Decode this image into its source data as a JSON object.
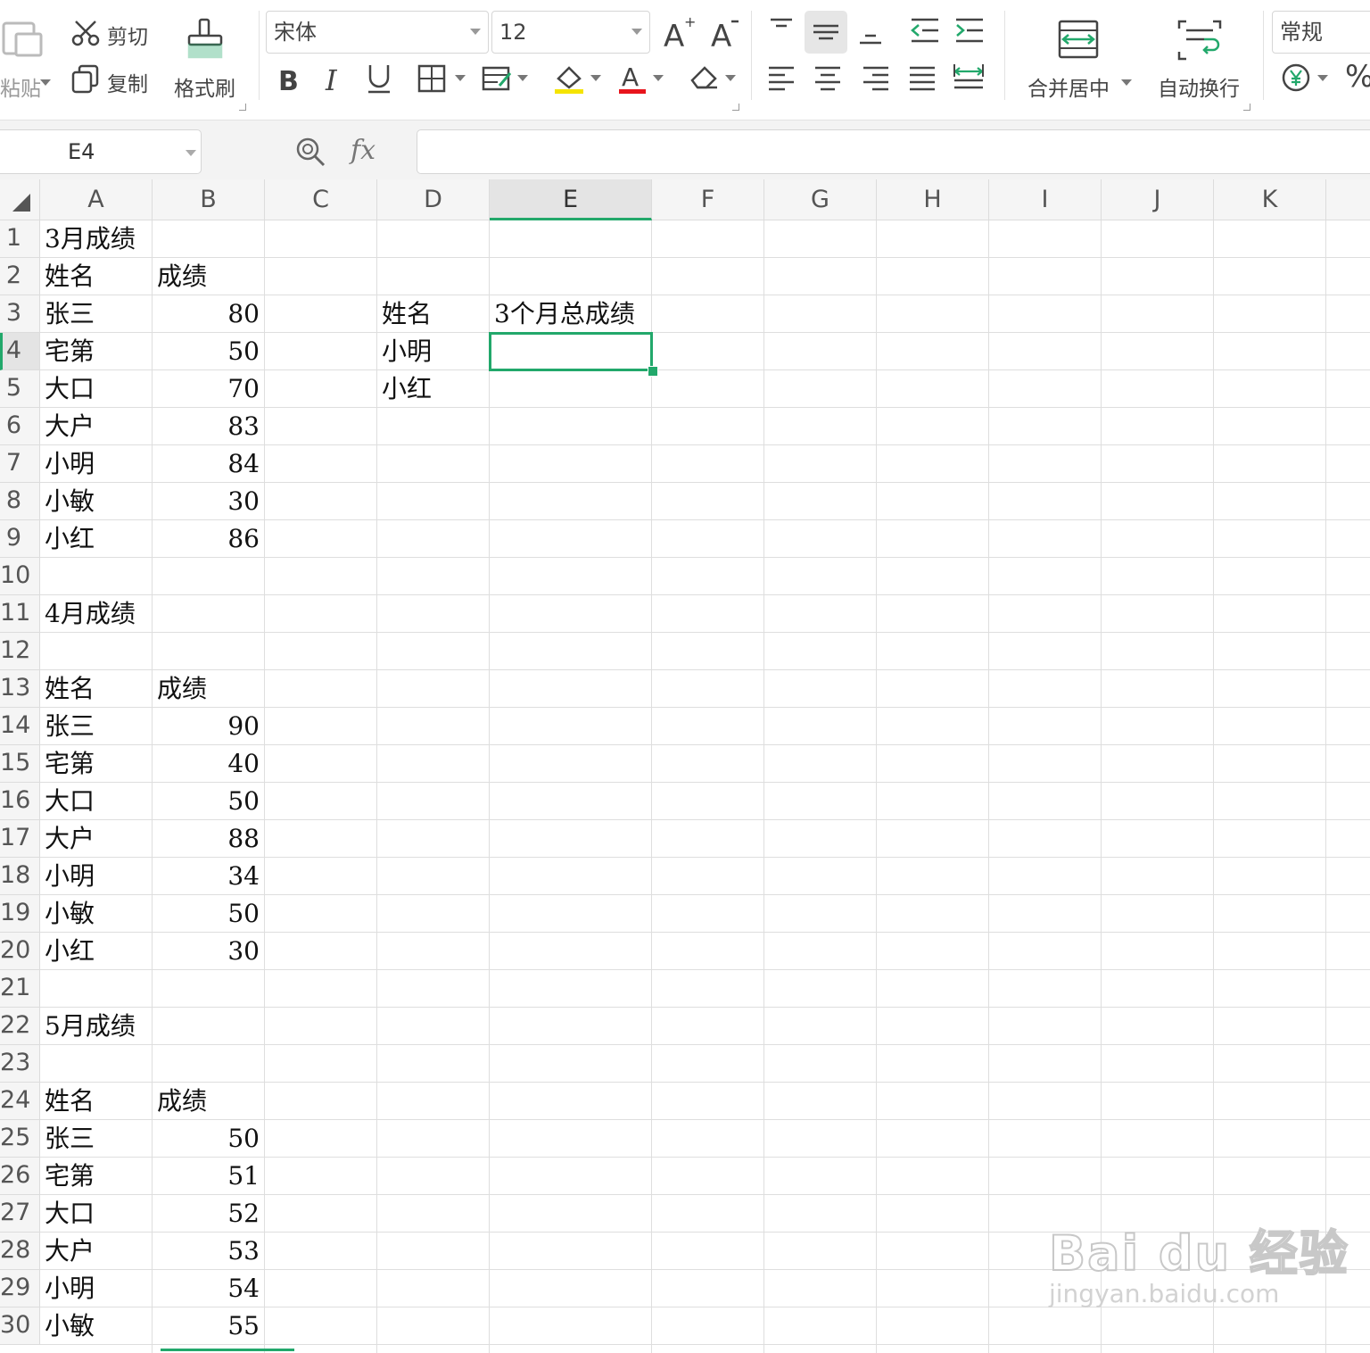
{
  "toolbar": {
    "paste_label": "粘贴",
    "cut_label": "剪切",
    "copy_label": "复制",
    "format_painter_label": "格式刷",
    "font_name": "宋体",
    "font_size": "12",
    "merge_center_label": "合并居中",
    "wrap_text_label": "自动换行",
    "number_format": "常规",
    "percent_symbol": "%",
    "accent_color": "#22a86b"
  },
  "formula_bar": {
    "name_box": "E4",
    "fx_label": "fx",
    "formula_value": ""
  },
  "sheet": {
    "columns": [
      "A",
      "B",
      "C",
      "D",
      "E",
      "F",
      "G",
      "H",
      "I",
      "J",
      "K"
    ],
    "selected_column": "E",
    "selected_row": "4",
    "selected_cell": "E4",
    "rows": [
      {
        "n": "1",
        "a": "3月成绩",
        "b": "",
        "d": "",
        "e": ""
      },
      {
        "n": "2",
        "a": "姓名",
        "b": "成绩",
        "d": "",
        "e": ""
      },
      {
        "n": "3",
        "a": "张三",
        "b": "80",
        "d": "姓名",
        "e": "3个月总成绩"
      },
      {
        "n": "4",
        "a": "宅第",
        "b": "50",
        "d": "小明",
        "e": ""
      },
      {
        "n": "5",
        "a": "大口",
        "b": "70",
        "d": "小红",
        "e": ""
      },
      {
        "n": "6",
        "a": "大户",
        "b": "83",
        "d": "",
        "e": ""
      },
      {
        "n": "7",
        "a": "小明",
        "b": "84",
        "d": "",
        "e": ""
      },
      {
        "n": "8",
        "a": "小敏",
        "b": "30",
        "d": "",
        "e": ""
      },
      {
        "n": "9",
        "a": "小红",
        "b": "86",
        "d": "",
        "e": ""
      },
      {
        "n": "10",
        "a": "",
        "b": "",
        "d": "",
        "e": ""
      },
      {
        "n": "11",
        "a": "4月成绩",
        "b": "",
        "d": "",
        "e": ""
      },
      {
        "n": "12",
        "a": "",
        "b": "",
        "d": "",
        "e": ""
      },
      {
        "n": "13",
        "a": "姓名",
        "b": "成绩",
        "d": "",
        "e": ""
      },
      {
        "n": "14",
        "a": "张三",
        "b": "90",
        "d": "",
        "e": ""
      },
      {
        "n": "15",
        "a": "宅第",
        "b": "40",
        "d": "",
        "e": ""
      },
      {
        "n": "16",
        "a": "大口",
        "b": "50",
        "d": "",
        "e": ""
      },
      {
        "n": "17",
        "a": "大户",
        "b": "88",
        "d": "",
        "e": ""
      },
      {
        "n": "18",
        "a": "小明",
        "b": "34",
        "d": "",
        "e": ""
      },
      {
        "n": "19",
        "a": "小敏",
        "b": "50",
        "d": "",
        "e": ""
      },
      {
        "n": "20",
        "a": "小红",
        "b": "30",
        "d": "",
        "e": ""
      },
      {
        "n": "21",
        "a": "",
        "b": "",
        "d": "",
        "e": ""
      },
      {
        "n": "22",
        "a": "5月成绩",
        "b": "",
        "d": "",
        "e": ""
      },
      {
        "n": "23",
        "a": "",
        "b": "",
        "d": "",
        "e": ""
      },
      {
        "n": "24",
        "a": "姓名",
        "b": "成绩",
        "d": "",
        "e": ""
      },
      {
        "n": "25",
        "a": "张三",
        "b": "50",
        "d": "",
        "e": ""
      },
      {
        "n": "26",
        "a": "宅第",
        "b": "51",
        "d": "",
        "e": ""
      },
      {
        "n": "27",
        "a": "大口",
        "b": "52",
        "d": "",
        "e": ""
      },
      {
        "n": "28",
        "a": "大户",
        "b": "53",
        "d": "",
        "e": ""
      },
      {
        "n": "29",
        "a": "小明",
        "b": "54",
        "d": "",
        "e": ""
      },
      {
        "n": "30",
        "a": "小敏",
        "b": "55",
        "d": "",
        "e": ""
      }
    ]
  },
  "watermark": {
    "brand": "Bai du 经验",
    "url": "jingyan.baidu.com"
  }
}
